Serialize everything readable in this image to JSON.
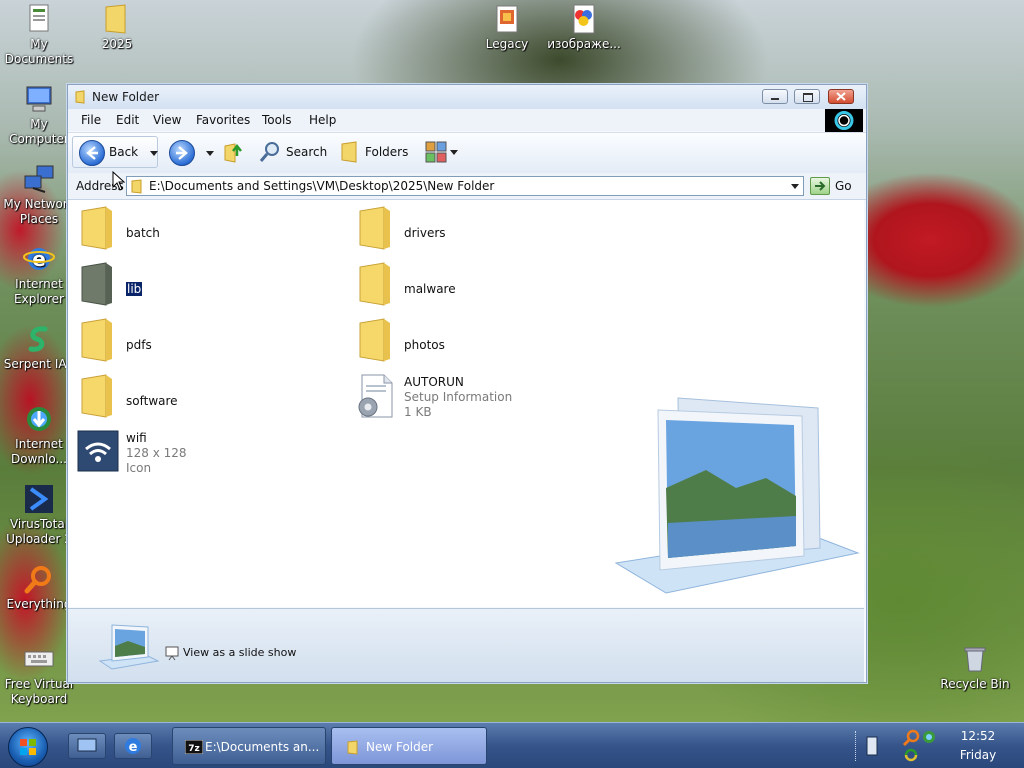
{
  "desktop": {
    "icons": [
      {
        "id": "my-documents",
        "label": "My\nDocuments"
      },
      {
        "id": "folder-2025",
        "label": "2025"
      },
      {
        "id": "legacy",
        "label": "Legacy"
      },
      {
        "id": "image",
        "label": "изображе..."
      },
      {
        "id": "my-computer",
        "label": "My Computer"
      },
      {
        "id": "network",
        "label": "My Network\nPlaces"
      },
      {
        "id": "ie",
        "label": "Internet\nExplorer"
      },
      {
        "id": "serpent",
        "label": "Serpent IA3"
      },
      {
        "id": "idm",
        "label": "Internet\nDownlo..."
      },
      {
        "id": "virustotal",
        "label": "VirusTotal\nUploader 2"
      },
      {
        "id": "everything",
        "label": "Everything"
      },
      {
        "id": "keyboard",
        "label": "Free Virtual\nKeyboard"
      },
      {
        "id": "recycle",
        "label": "Recycle Bin"
      }
    ]
  },
  "window": {
    "title": "New Folder",
    "menu": [
      "File",
      "Edit",
      "View",
      "Favorites",
      "Tools",
      "Help"
    ],
    "toolbar": {
      "back_label": "Back",
      "search_label": "Search",
      "folders_label": "Folders"
    },
    "address": {
      "label": "Address",
      "path": "E:\\Documents and Settings\\VM\\Desktop\\2025\\New Folder",
      "go_label": "Go"
    },
    "items": [
      {
        "name": "batch",
        "type": "folder"
      },
      {
        "name": "drivers",
        "type": "folder"
      },
      {
        "name": "lib",
        "type": "folder-dark",
        "selected": true
      },
      {
        "name": "malware",
        "type": "folder"
      },
      {
        "name": "pdfs",
        "type": "folder"
      },
      {
        "name": "photos",
        "type": "folder"
      },
      {
        "name": "software",
        "type": "folder"
      },
      {
        "name": "AUTORUN",
        "type": "setup",
        "sub1": "Setup Information",
        "sub2": "1 KB"
      },
      {
        "name": "wifi",
        "type": "icon-file",
        "sub1": "128 x 128",
        "sub2": "Icon"
      }
    ],
    "task": {
      "slideshow_label": "View as a slide show"
    }
  },
  "taskbar": {
    "tasks": [
      {
        "label": "E:\\Documents an...",
        "active": false
      },
      {
        "label": "New Folder",
        "active": true
      }
    ],
    "clock": {
      "time": "12:52",
      "day": "Friday"
    }
  },
  "colors": {
    "selection": "#0a246a",
    "title_bg": "#d3e1f2",
    "taskbar": "#35548a"
  }
}
